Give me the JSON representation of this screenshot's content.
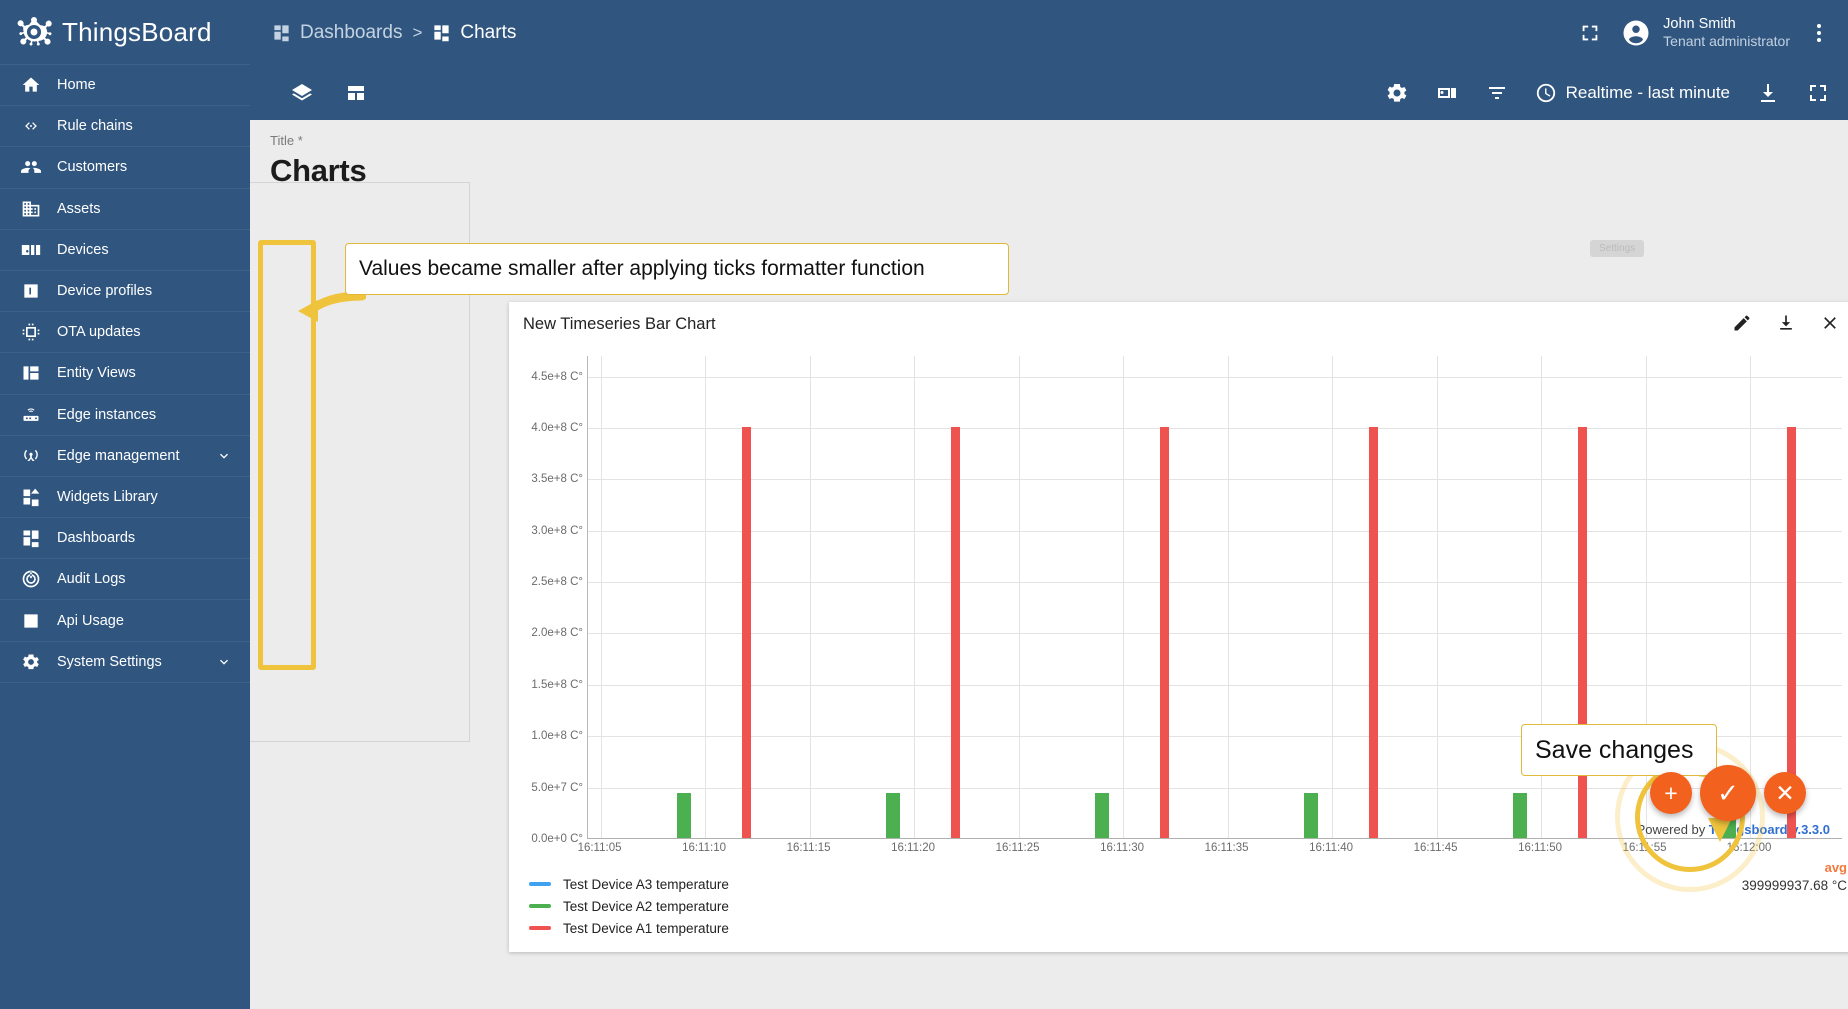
{
  "brand": {
    "name": "ThingsBoard"
  },
  "sidebar": {
    "items": [
      {
        "label": "Home",
        "icon": "home-icon",
        "expandable": false
      },
      {
        "label": "Rule chains",
        "icon": "rule-chains-icon",
        "expandable": false
      },
      {
        "label": "Customers",
        "icon": "customers-icon",
        "expandable": false
      },
      {
        "label": "Assets",
        "icon": "assets-icon",
        "expandable": false
      },
      {
        "label": "Devices",
        "icon": "devices-icon",
        "expandable": false
      },
      {
        "label": "Device profiles",
        "icon": "device-profiles-icon",
        "expandable": false
      },
      {
        "label": "OTA updates",
        "icon": "ota-updates-icon",
        "expandable": false
      },
      {
        "label": "Entity Views",
        "icon": "entity-views-icon",
        "expandable": false
      },
      {
        "label": "Edge instances",
        "icon": "edge-instances-icon",
        "expandable": false
      },
      {
        "label": "Edge management",
        "icon": "edge-management-icon",
        "expandable": true
      },
      {
        "label": "Widgets Library",
        "icon": "widgets-library-icon",
        "expandable": false
      },
      {
        "label": "Dashboards",
        "icon": "dashboards-icon",
        "expandable": false
      },
      {
        "label": "Audit Logs",
        "icon": "audit-logs-icon",
        "expandable": false
      },
      {
        "label": "Api Usage",
        "icon": "api-usage-icon",
        "expandable": false
      },
      {
        "label": "System Settings",
        "icon": "system-settings-icon",
        "expandable": true
      }
    ]
  },
  "topbar": {
    "breadcrumb": [
      {
        "label": "Dashboards",
        "icon": "dashboards-icon"
      },
      {
        "label": "Charts",
        "icon": "dashboards-icon"
      }
    ],
    "separator": ">",
    "fullscreen_icon": "fullscreen-icon",
    "user": {
      "name": "John Smith",
      "role": "Tenant administrator",
      "avatar_icon": "account-circle-icon"
    },
    "more_icon": "kebab-menu-icon"
  },
  "dashboard_toolbar": {
    "layers_icon": "layers-icon",
    "states_icon": "dashboard-layout-icon",
    "settings_icon": "gear-icon",
    "devices_icon": "device-group-icon",
    "filters_icon": "filter-icon",
    "timewindow_icon": "clock-icon",
    "timewindow_label": "Realtime - last minute",
    "export_icon": "download-icon",
    "expand_icon": "fullscreen-icon",
    "settings_tooltip": "Settings"
  },
  "page": {
    "title_label": "Title *",
    "title_value": "Charts"
  },
  "widget": {
    "title": "New Timeseries Bar Chart",
    "actions": [
      {
        "name": "edit-widget-button",
        "icon": "pencil-icon"
      },
      {
        "name": "export-widget-button",
        "icon": "download-icon"
      },
      {
        "name": "remove-widget-button",
        "icon": "close-icon"
      }
    ]
  },
  "chart_data": {
    "type": "bar",
    "title": "New Timeseries Bar Chart",
    "xlabel": "",
    "ylabel": "",
    "ylim": [
      0,
      470000000
    ],
    "grid": true,
    "legend_position": "bottom-left",
    "y_ticks": [
      {
        "value": 0,
        "label": "0.0e+0 C°"
      },
      {
        "value": 50000000,
        "label": "5.0e+7 C°"
      },
      {
        "value": 100000000,
        "label": "1.0e+8 C°"
      },
      {
        "value": 150000000,
        "label": "1.5e+8 C°"
      },
      {
        "value": 200000000,
        "label": "2.0e+8 C°"
      },
      {
        "value": 250000000,
        "label": "2.5e+8 C°"
      },
      {
        "value": 300000000,
        "label": "3.0e+8 C°"
      },
      {
        "value": 350000000,
        "label": "3.5e+8 C°"
      },
      {
        "value": 400000000,
        "label": "4.0e+8 C°"
      },
      {
        "value": 450000000,
        "label": "4.5e+8 C°"
      }
    ],
    "x_ticks": [
      "16:11:05",
      "16:11:10",
      "16:11:15",
      "16:11:20",
      "16:11:25",
      "16:11:30",
      "16:11:35",
      "16:11:40",
      "16:11:45",
      "16:11:50",
      "16:11:55",
      "16:12:00"
    ],
    "series": [
      {
        "name": "Test Device A3 temperature",
        "color": "#3ea2f0",
        "x": [
          "16:11:09",
          "16:11:19",
          "16:11:29",
          "16:11:39",
          "16:11:49",
          "16:11:59"
        ],
        "values": [
          40000000,
          40000000,
          40000000,
          40000000,
          40000000,
          40000000
        ]
      },
      {
        "name": "Test Device A2 temperature",
        "color": "#4caf50",
        "x": [
          "16:11:09",
          "16:11:19",
          "16:11:29",
          "16:11:39",
          "16:11:49",
          "16:11:59"
        ],
        "values": [
          44000000,
          44000000,
          44000000,
          44000000,
          44000000,
          44000000
        ]
      },
      {
        "name": "Test Device A1 temperature",
        "color": "#ef5350",
        "x": [
          "16:11:12",
          "16:11:22",
          "16:11:32",
          "16:11:42",
          "16:11:52",
          "16:12:02"
        ],
        "values": [
          400000000,
          400000000,
          400000000,
          400000000,
          400000000,
          400000000
        ]
      }
    ],
    "annotations": [
      {
        "label": "avg",
        "value": "399999937.68 °C",
        "color": "#f4793c"
      }
    ]
  },
  "legend": [
    {
      "label": "Test Device A3 temperature",
      "color": "#3ea2f0"
    },
    {
      "label": "Test Device A2 temperature",
      "color": "#4caf50"
    },
    {
      "label": "Test Device A1 temperature",
      "color": "#ef5350"
    }
  ],
  "annotations": {
    "callout_ticks": "Values became smaller after applying ticks formatter function",
    "callout_save": "Save changes",
    "highlight_color": "#f0c33c"
  },
  "fabs": [
    {
      "name": "add-widget-button",
      "icon": "plus-icon",
      "label": "+"
    },
    {
      "name": "apply-changes-button",
      "icon": "check-icon",
      "label": "✓"
    },
    {
      "name": "cancel-changes-button",
      "icon": "close-icon",
      "label": "✕"
    }
  ],
  "footer": {
    "powered_prefix": "Powered by ",
    "powered_link": "Thingsboard v.3.3.0"
  }
}
